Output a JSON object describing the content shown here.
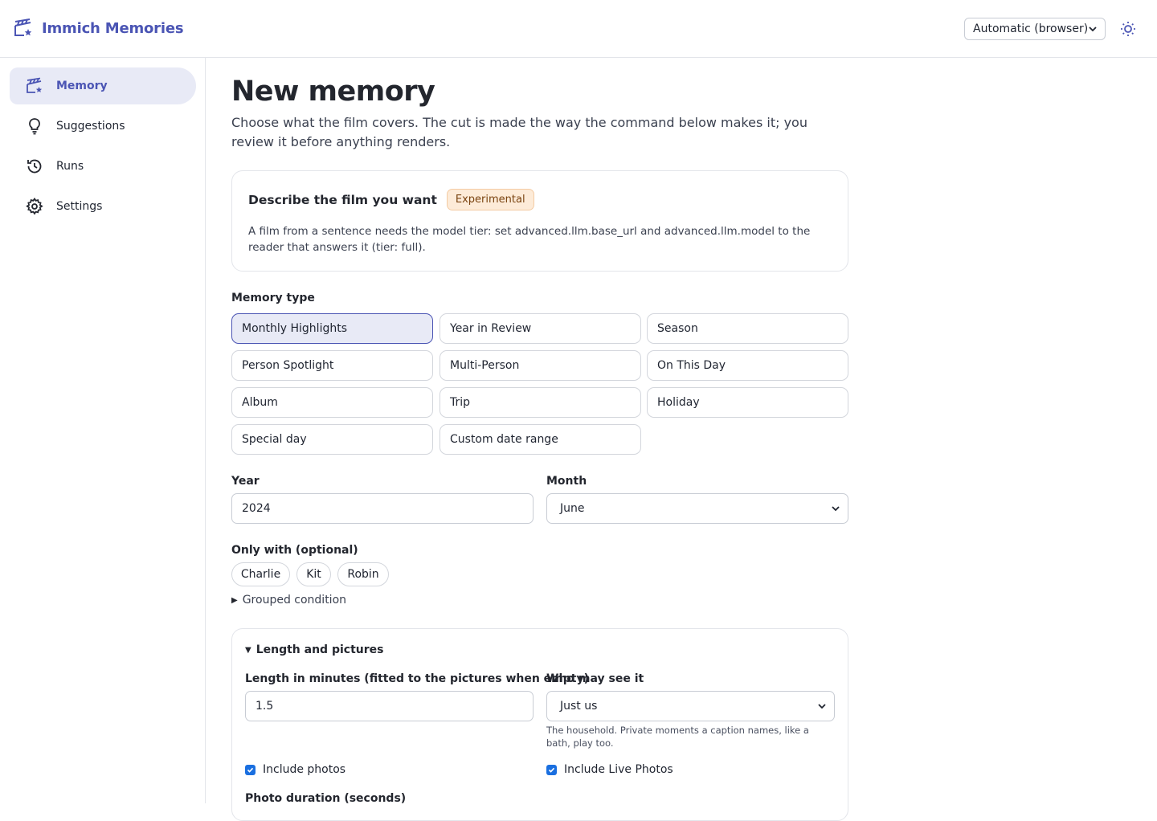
{
  "app": {
    "title": "Immich Memories",
    "theme_select": "Automatic (browser)"
  },
  "sidebar": {
    "items": [
      {
        "label": "Memory",
        "icon": "clapperboard-sparkle-icon",
        "active": true
      },
      {
        "label": "Suggestions",
        "icon": "lightbulb-icon",
        "active": false
      },
      {
        "label": "Runs",
        "icon": "history-icon",
        "active": false
      },
      {
        "label": "Settings",
        "icon": "gear-icon",
        "active": false
      }
    ]
  },
  "page": {
    "title": "New memory",
    "lede": "Choose what the film covers. The cut is made the way the command below makes it; you review it before anything renders."
  },
  "describe_card": {
    "title": "Describe the film you want",
    "badge": "Experimental",
    "body": "A film from a sentence needs the model tier: set advanced.llm.base_url and advanced.llm.model to the reader that answers it (tier: full)."
  },
  "memory_type": {
    "label": "Memory type",
    "selected": "Monthly Highlights",
    "options": [
      "Monthly Highlights",
      "Year in Review",
      "Season",
      "Person Spotlight",
      "Multi-Person",
      "On This Day",
      "Album",
      "Trip",
      "Holiday",
      "Special day",
      "Custom date range"
    ]
  },
  "year": {
    "label": "Year",
    "value": "2024"
  },
  "month": {
    "label": "Month",
    "value": "June"
  },
  "only_with": {
    "label": "Only with (optional)",
    "people": [
      "Charlie",
      "Kit",
      "Robin"
    ]
  },
  "grouped_condition": {
    "label": "Grouped condition"
  },
  "length_section": {
    "title": "Length and pictures",
    "length_label": "Length in minutes (fitted to the pictures when empty)",
    "length_value": "1.5",
    "visibility_label": "Who may see it",
    "visibility_value": "Just us",
    "visibility_hint": "The household. Private moments a caption names, like a bath, play too.",
    "include_photos": {
      "label": "Include photos",
      "checked": true
    },
    "include_live_photos": {
      "label": "Include Live Photos",
      "checked": true
    },
    "photo_duration_label": "Photo duration (seconds)"
  },
  "colors": {
    "accent": "#4b55b4",
    "accent_bg": "#e8eaf6",
    "badge_bg": "#fdebd8",
    "checkbox": "#1a6fe0"
  }
}
